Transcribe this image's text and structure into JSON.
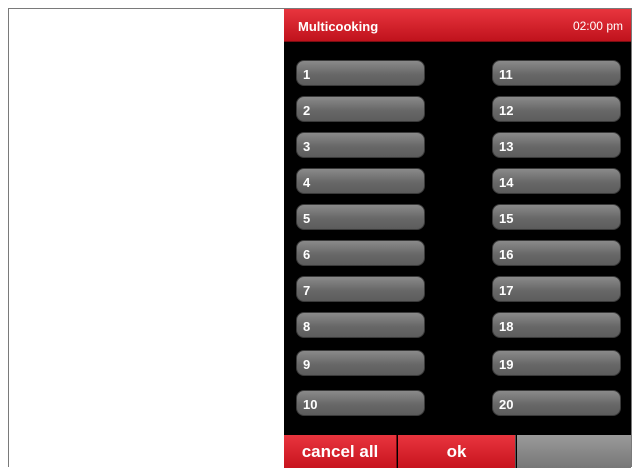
{
  "header": {
    "title": "Multicooking",
    "time": "02:00 pm"
  },
  "slots_left": [
    "1",
    "2",
    "3",
    "4",
    "5",
    "6",
    "7",
    "8",
    "9",
    "10"
  ],
  "slots_right": [
    "11",
    "12",
    "13",
    "14",
    "15",
    "16",
    "17",
    "18",
    "19",
    "20"
  ],
  "footer": {
    "cancel_all_label": "cancel all",
    "ok_label": "ok"
  },
  "colors": {
    "accent_red": "#d81f28",
    "slot_gray": "#6e6e6e",
    "screen_bg": "#000000"
  }
}
